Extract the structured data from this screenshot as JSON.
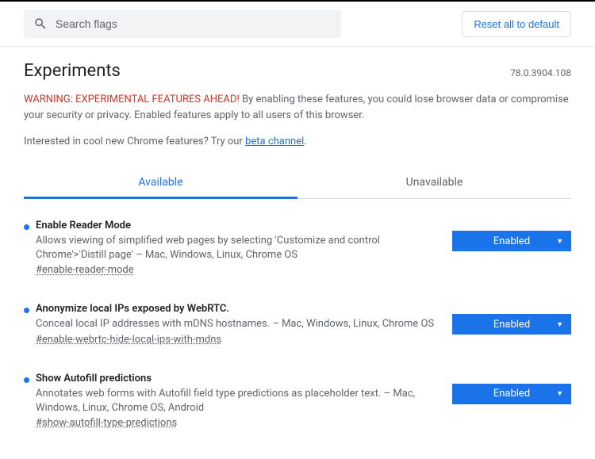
{
  "search": {
    "placeholder": "Search flags"
  },
  "reset_label": "Reset all to default",
  "title": "Experiments",
  "version": "78.0.3904.108",
  "warning": {
    "prefix": "WARNING: EXPERIMENTAL FEATURES AHEAD!",
    "body": " By enabling these features, you could lose browser data or compromise your security or privacy. Enabled features apply to all users of this browser."
  },
  "interest": {
    "prefix": "Interested in cool new Chrome features? Try our ",
    "link": "beta channel",
    "suffix": "."
  },
  "tabs": {
    "available": "Available",
    "unavailable": "Unavailable"
  },
  "flags": [
    {
      "title": "Enable Reader Mode",
      "desc": "Allows viewing of simplified web pages by selecting 'Customize and control Chrome'>'Distill page' – Mac, Windows, Linux, Chrome OS",
      "anchor": "#enable-reader-mode",
      "value": "Enabled"
    },
    {
      "title": "Anonymize local IPs exposed by WebRTC.",
      "desc": "Conceal local IP addresses with mDNS hostnames. – Mac, Windows, Linux, Chrome OS",
      "anchor": "#enable-webrtc-hide-local-ips-with-mdns",
      "value": "Enabled"
    },
    {
      "title": "Show Autofill predictions",
      "desc": "Annotates web forms with Autofill field type predictions as placeholder text. – Mac, Windows, Linux, Chrome OS, Android",
      "anchor": "#show-autofill-type-predictions",
      "value": "Enabled"
    }
  ]
}
